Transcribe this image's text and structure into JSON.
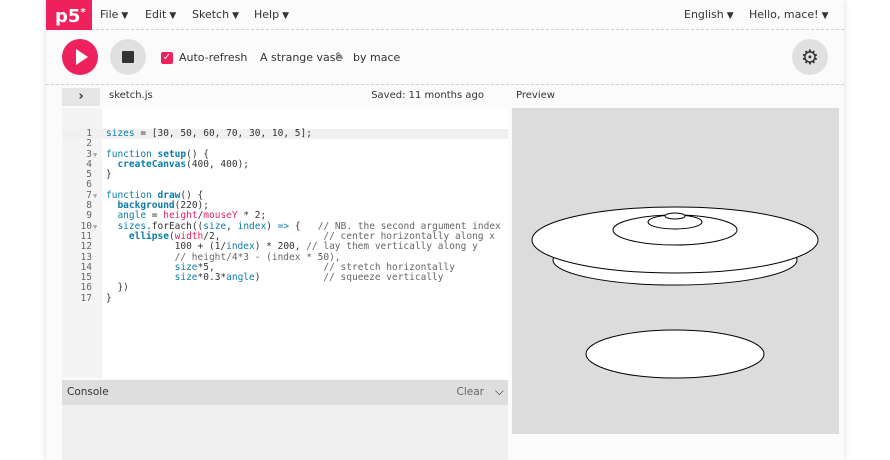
{
  "nav": {
    "logo": "p5",
    "logo_sup": "*",
    "menus": [
      {
        "label": "File",
        "icon": "caret-down-icon"
      },
      {
        "label": "Edit",
        "icon": "caret-down-icon"
      },
      {
        "label": "Sketch",
        "icon": "caret-down-icon"
      },
      {
        "label": "Help",
        "icon": "caret-down-icon"
      }
    ],
    "language": "English",
    "user": "Hello, mace!"
  },
  "toolbar": {
    "play_icon": "play-icon",
    "stop_icon": "stop-icon",
    "auto_refresh_label": "Auto-refresh",
    "auto_refresh_checked": true,
    "sketch_name": "A strange vase",
    "edit_icon": "pencil-icon",
    "owner": "by mace",
    "settings_icon": "gear-icon"
  },
  "editor": {
    "file_name": "sketch.js",
    "saved_status": "Saved: 11 months ago",
    "expand_icon": "chevron-right-icon",
    "lines": [
      "sizes = [30, 50, 60, 70, 30, 10, 5];",
      "",
      "function setup() {",
      "  createCanvas(400, 400);",
      "}",
      "",
      "function draw() {",
      "  background(220);",
      "  angle = height/mouseY * 2;",
      "  sizes.forEach((size, index) => {   // NB. the second argument index",
      "    ellipse(width/2,                  // center horizontally along x",
      "            100 + (1/index) * 200, // lay them vertically along y",
      "            // height/4*3 - (index * 50),",
      "            size*5,                   // stretch horizontally",
      "            size*0.3*angle)           // squeeze vertically",
      "  })",
      "}"
    ],
    "active_line": 1,
    "fold_lines": [
      3,
      7,
      10
    ]
  },
  "preview": {
    "label": "Preview",
    "background": "#dcdcdc"
  },
  "console": {
    "title": "Console",
    "clear_label": "Clear",
    "toggle_icon": "chevron-down-icon"
  },
  "colors": {
    "accent": "#ed225d",
    "keyword": "#0b7ca9",
    "comment": "#666666"
  }
}
